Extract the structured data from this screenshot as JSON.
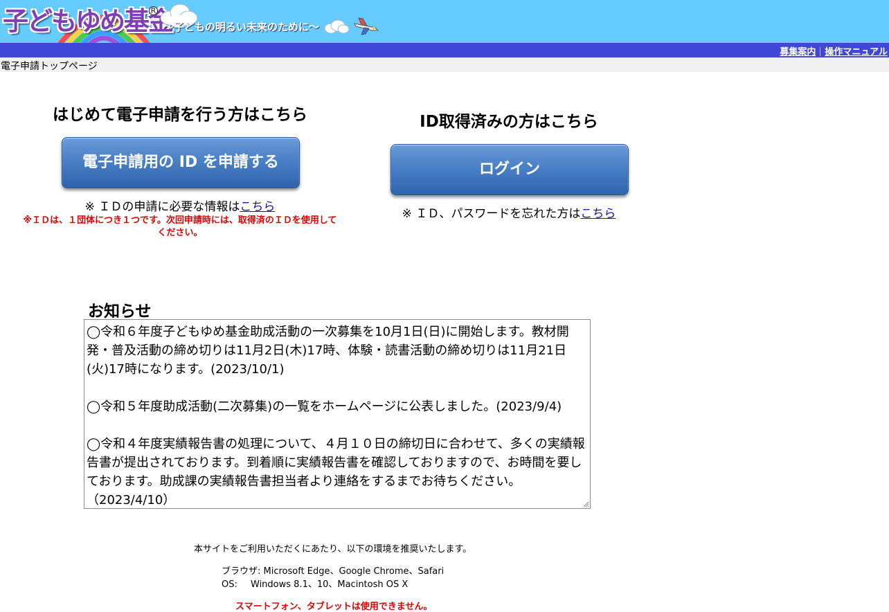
{
  "header": {
    "logo_text": "子どもゆめ基金",
    "registered_mark": "R",
    "tagline": "〜子どもの明るい未来のために〜"
  },
  "nav": {
    "recruit_link": "募集案内",
    "manual_link": "操作マニュアル"
  },
  "breadcrumb": "電子申請トップページ",
  "left": {
    "heading": "はじめて電子申請を行う方はこちら",
    "button_label": "電子申請用の ID を申請する",
    "note_prefix": "※ ＩＤの申請に必要な情報は",
    "note_link": "こちら",
    "warning": "※ＩＤは、１団体につき１つです。次回申請時には、取得済のＩＤを使用してください。"
  },
  "right": {
    "heading": "ID取得済みの方はこちら",
    "button_label": "ログイン",
    "note_prefix": "※ ＩＤ、パスワードを忘れた方は",
    "note_link": "こちら"
  },
  "notice": {
    "heading": "お知らせ",
    "items": [
      "◯令和６年度子どもゆめ基金助成活動の一次募集を10月1日(日)に開始します。教材開発・普及活動の締め切りは11月2日(木)17時、体験・読書活動の締め切りは11月21日(火)17時になります。(2023/10/1)",
      "◯令和５年度助成活動(二次募集)の一覧をホームページに公表しました。(2023/9/4)",
      "◯令和４年度実績報告書の処理について、４月１０日の締切日に合わせて、多くの実績報告書が提出されております。到着順に実績報告書を確認しておりますので、お時間を要しております。助成課の実績報告書担当者より連絡をするまでお待ちください。（2023/4/10）"
    ]
  },
  "footer": {
    "intro": "本サイトをご利用いただくにあたり、以下の環境を推奨いたします。",
    "browser": "ブラウザ: Microsoft Edge、Google Chrome、Safari",
    "os_label": "OS:",
    "os_value": "Windows 8.1、10、Macintosh OS X",
    "warning": "スマートフォン、タブレットは使用できません。"
  },
  "colors": {
    "header_bg": "#66ccff",
    "nav_bg": "#3f46d8",
    "button": "#4a80c6",
    "warning": "#e00000",
    "logo": "#7e3fb3"
  }
}
